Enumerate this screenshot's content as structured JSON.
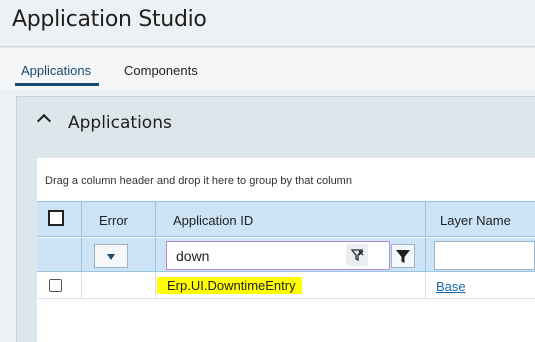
{
  "app": {
    "title": "Application Studio"
  },
  "tabs": [
    {
      "label": "Applications",
      "active": true
    },
    {
      "label": "Components",
      "active": false
    }
  ],
  "panel": {
    "title": "Applications",
    "collapsed": false
  },
  "grid": {
    "group_hint": "Drag a column header and drop it here to group by that column",
    "columns": [
      {
        "key": "select",
        "label": ""
      },
      {
        "key": "error",
        "label": "Error"
      },
      {
        "key": "application_id",
        "label": "Application ID"
      },
      {
        "key": "layer_name",
        "label": "Layer Name"
      }
    ],
    "filters": {
      "error_dropdown": "",
      "application_id": "down",
      "layer_name": ""
    },
    "rows": [
      {
        "selected": false,
        "error": "",
        "application_id": "Erp.UI.DowntimeEntry",
        "layer_name": "Base"
      }
    ]
  },
  "colors": {
    "accent": "#1a4a6e",
    "header_bg": "#cce4f6",
    "highlight": "#ffff00",
    "link": "#1a6aa8"
  },
  "icons": {
    "collapse": "chevron-up-icon",
    "dropdown": "caret-down-icon",
    "clear_filter": "clear-filter-icon",
    "filter": "funnel-icon"
  }
}
